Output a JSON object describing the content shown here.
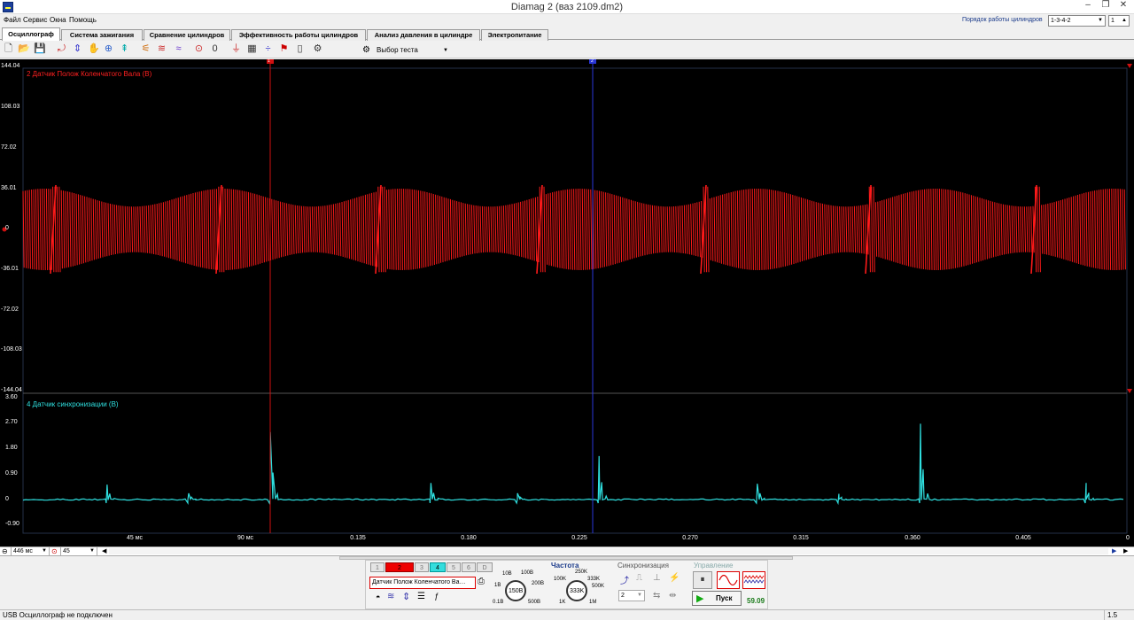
{
  "window": {
    "title": "Diamag 2 (ваз 2109.dm2)"
  },
  "menu": [
    "Файл",
    "Сервис",
    "Окна",
    "Помощь"
  ],
  "cylinder_order": {
    "label": "Порядок работы цилиндров",
    "value": "1-3-4-2",
    "count": "1"
  },
  "tabs": [
    "Осциллограф",
    "Система зажигания",
    "Сравнение цилиндров",
    "Эффективность работы цилиндров",
    "Анализ давления в цилиндре",
    "Электропитание"
  ],
  "toolbar": {
    "test_select": "Выбор теста"
  },
  "plot": {
    "ch2_label": "2 Датчик Полож Коленчатого Вала (В)",
    "ch4_label": "4 Датчик синхронизации (В)",
    "ch2_ticks": [
      "144.04",
      "108.03",
      "72.02",
      "36.01",
      "0",
      "-36.01",
      "-72.02",
      "-108.03",
      "-144.04"
    ],
    "ch4_ticks": [
      "3.60",
      "2.70",
      "1.80",
      "0.90",
      "0",
      "-0.90"
    ],
    "x_ticks": [
      "45 мс",
      "90 мс",
      "0.135",
      "0.180",
      "0.225",
      "0.270",
      "0.315",
      "0.360",
      "0.405",
      "0"
    ],
    "cursor1": "1",
    "cursor2": "2"
  },
  "chart_data": [
    {
      "type": "line",
      "title": "2 Датчик Полож Коленчатого Вала (В)",
      "ylim": [
        -144.04,
        144.04
      ],
      "note_series": "high-frequency signal with amplitude about ±36 V, amplitude modulated, with sync spikes near ~0.015, 0.08, 0.142, 0.212, 0.283, 0.355, 0.42 s",
      "series": [
        {
          "values": []
        }
      ]
    },
    {
      "type": "line",
      "title": "4 Датчик синхронизации (В)",
      "ylim": [
        -0.9,
        3.6
      ],
      "x": [
        0.034,
        0.067,
        0.1,
        0.165,
        0.2,
        0.233,
        0.297,
        0.33,
        0.363,
        0.43
      ],
      "series": [
        {
          "values": [
            0.52,
            0.22,
            2.36,
            0.58,
            0.22,
            1.52,
            0.55,
            0.2,
            2.65,
            0.58
          ]
        }
      ]
    }
  ],
  "scroll": {
    "time_window": "446 мс",
    "value": "45"
  },
  "bottom": {
    "channels": [
      "1",
      "2",
      "3",
      "4",
      "5",
      "6",
      "D"
    ],
    "sensor": "Датчик Полож Коленчатого Ва…",
    "volt_ticks": [
      "10В",
      "100В",
      "1В",
      "200В",
      "0.1В",
      "500В"
    ],
    "volt_value": "150В",
    "freq_title": "Частота",
    "freq_ticks": [
      "100K",
      "250K",
      "333K",
      "500K",
      "1K",
      "1M"
    ],
    "freq_value": "333K",
    "sync_title": "Синхронизация",
    "sync_channel": "2",
    "control_title": "Управление",
    "start_label": "Пуск",
    "rate": "59.09"
  },
  "status": {
    "text": "USB Осциллограф не подключен",
    "version": "1.5"
  }
}
